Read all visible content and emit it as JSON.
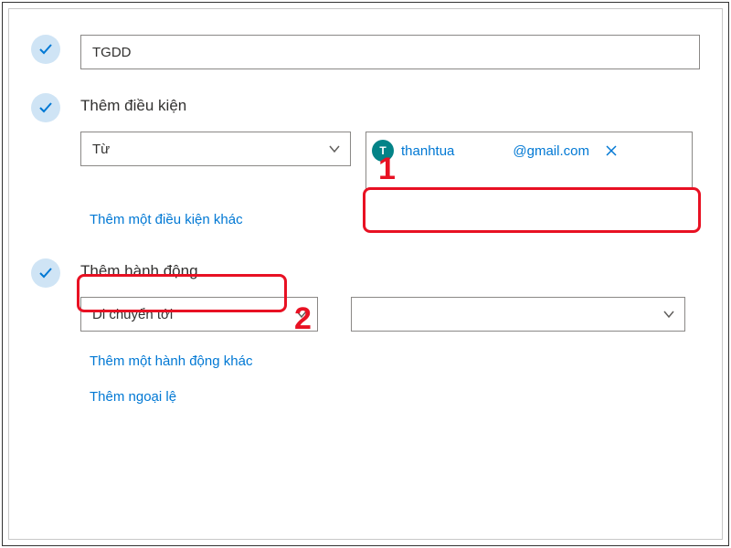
{
  "rule": {
    "name_value": "TGDD"
  },
  "conditions": {
    "title": "Thêm điều kiện",
    "dropdown_label": "Từ",
    "email": {
      "avatar_initial": "T",
      "username": "thanhtua",
      "domain": "@gmail.com"
    },
    "add_another": "Thêm một điều kiện khác"
  },
  "actions": {
    "title": "Thêm hành động",
    "dropdown_label": "Di chuyển tới",
    "target_placeholder": "",
    "add_another": "Thêm một hành động khác",
    "add_exception": "Thêm ngoại lệ"
  },
  "annotations": {
    "num1": "1",
    "num2": "2"
  }
}
